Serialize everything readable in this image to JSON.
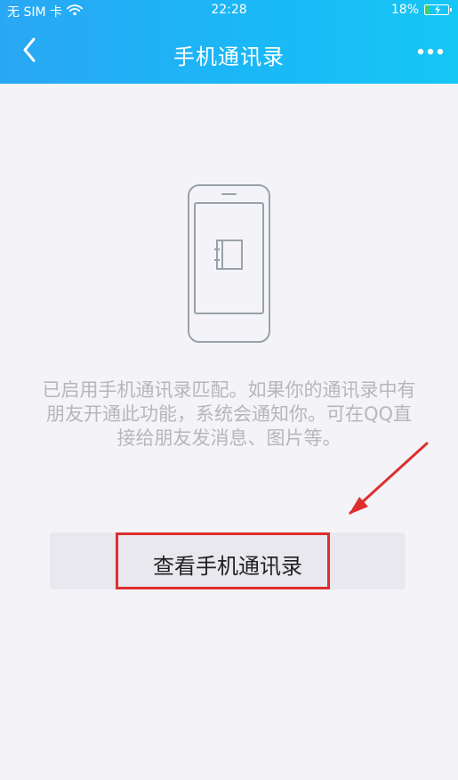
{
  "status_bar": {
    "carrier": "无 SIM 卡",
    "time": "22:28",
    "battery_percent": "18%",
    "battery_level": 0.18,
    "wifi_icon": "wifi-icon",
    "battery_icon": "battery-icon"
  },
  "nav": {
    "title": "手机通讯录",
    "back_icon": "chevron-left-icon",
    "more_icon": "more-horizontal-icon"
  },
  "illustration": {
    "icon": "phone-contacts-illustration"
  },
  "description": "已启用手机通讯录匹配。如果你的通讯录中有朋友开通此功能，系统会通知你。可在QQ直接给朋友发消息、图片等。",
  "action": {
    "label": "查看手机通讯录"
  },
  "annotations": {
    "arrow_icon": "red-arrow-icon",
    "highlight_color": "#df2e2e"
  },
  "colors": {
    "header_start": "#2aa7f4",
    "header_end": "#16c6f5",
    "background": "#f4f4f8",
    "button_bg": "#e8e8ee",
    "description_text": "#b7b7b9",
    "highlight": "#df2e2e"
  }
}
